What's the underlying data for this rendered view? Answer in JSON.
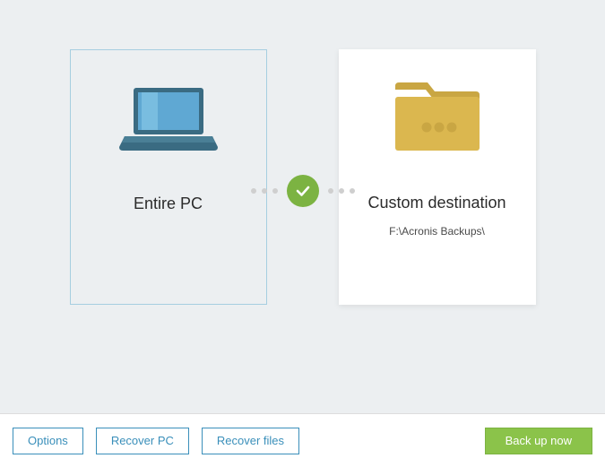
{
  "source": {
    "title": "Entire PC"
  },
  "destination": {
    "title": "Custom destination",
    "path": "F:\\Acronis Backups\\"
  },
  "footer": {
    "options": "Options",
    "recover_pc": "Recover PC",
    "recover_files": "Recover files",
    "backup_now": "Back up now"
  },
  "icons": {
    "laptop": "laptop-icon",
    "folder": "folder-icon",
    "check": "checkmark-icon"
  },
  "colors": {
    "accent_blue": "#3a8fba",
    "accent_green": "#8bc34a",
    "folder": "#dbb74f",
    "screen": "#5fa8d3"
  }
}
